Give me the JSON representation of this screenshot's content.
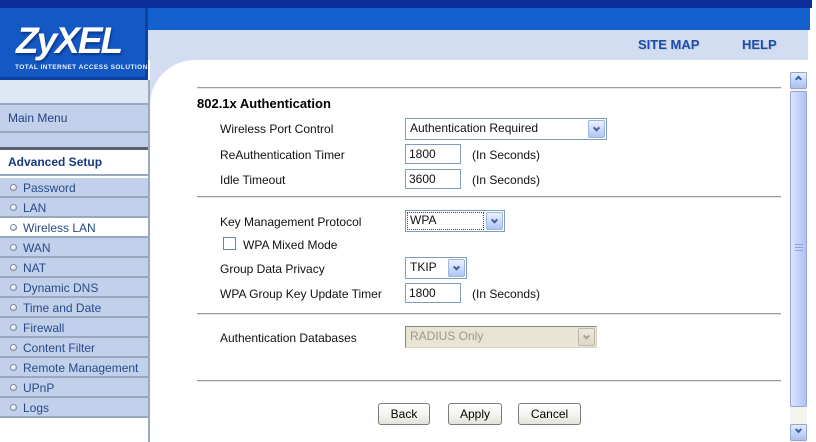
{
  "header": {
    "logo": {
      "brand": "ZyXEL",
      "tagline": "TOTAL INTERNET ACCESS SOLUTION"
    },
    "links": [
      {
        "label": "SITE MAP"
      },
      {
        "label": "HELP"
      }
    ]
  },
  "sidebar": {
    "main_menu_label": "Main Menu",
    "section_label": "Advanced Setup",
    "items": [
      {
        "label": "Password",
        "selected": false
      },
      {
        "label": "LAN",
        "selected": false
      },
      {
        "label": "Wireless LAN",
        "selected": true
      },
      {
        "label": "WAN",
        "selected": false
      },
      {
        "label": "NAT",
        "selected": false
      },
      {
        "label": "Dynamic DNS",
        "selected": false
      },
      {
        "label": "Time and Date",
        "selected": false
      },
      {
        "label": "Firewall",
        "selected": false
      },
      {
        "label": "Content Filter",
        "selected": false
      },
      {
        "label": "Remote Management",
        "selected": false
      },
      {
        "label": "UPnP",
        "selected": false
      },
      {
        "label": "Logs",
        "selected": false
      }
    ]
  },
  "form": {
    "title": "802.1x Authentication",
    "wireless_port_control": {
      "label": "Wireless Port Control",
      "value": "Authentication Required"
    },
    "reauth_timer": {
      "label": "ReAuthentication Timer",
      "value": "1800",
      "suffix": "(In Seconds)"
    },
    "idle_timeout": {
      "label": "Idle Timeout",
      "value": "3600",
      "suffix": "(In Seconds)"
    },
    "key_management_protocol": {
      "label": "Key Management Protocol",
      "value": "WPA",
      "focused": true
    },
    "wpa_mixed_mode": {
      "label": "WPA Mixed Mode",
      "checked": false
    },
    "group_data_privacy": {
      "label": "Group Data Privacy",
      "value": "TKIP"
    },
    "wpa_group_key_update_timer": {
      "label": "WPA Group Key Update Timer",
      "value": "1800",
      "suffix": "(In Seconds)"
    },
    "authentication_databases": {
      "label": "Authentication Databases",
      "value": "RADIUS Only",
      "disabled": true
    },
    "buttons": {
      "back": "Back",
      "apply": "Apply",
      "cancel": "Cancel"
    }
  },
  "icons": {
    "dropdown_arrow": "chevron-down",
    "scroll_up": "chevron-up",
    "scroll_down": "chevron-down",
    "sidebar_bullet": "radio-circle"
  },
  "colors": {
    "top_strip": "#0b2e9a",
    "header_blue": "#1560cf",
    "logo_blue": "#1458c4",
    "band_lavender": "#d3ddf2",
    "sidebar_item": "#c2d0ec",
    "link_blue": "#1c4ea6",
    "disabled_field_bg": "#e9e5d3",
    "control_border": "#7f9db9"
  }
}
